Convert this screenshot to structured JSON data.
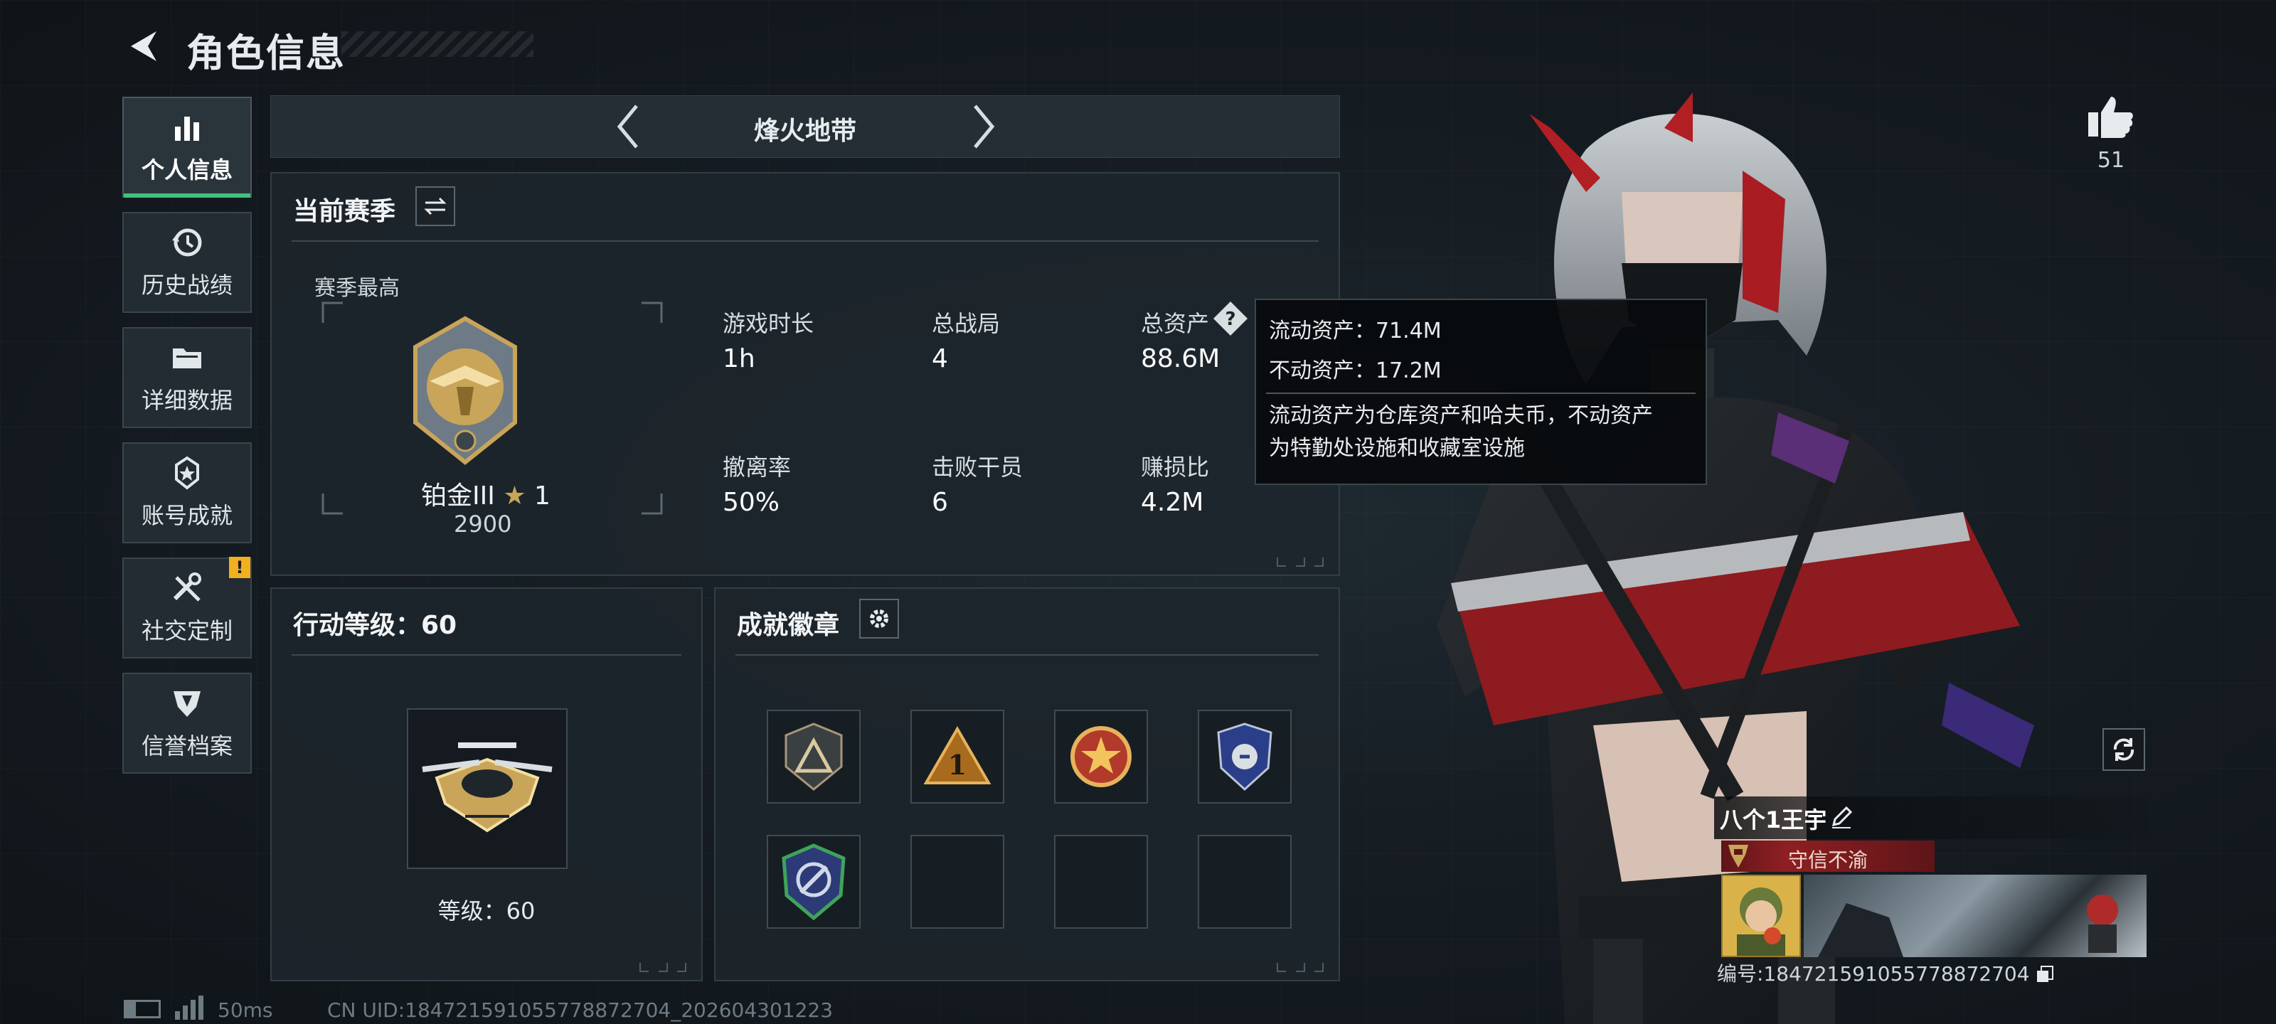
{
  "header": {
    "title": "角色信息"
  },
  "sidebar": {
    "items": [
      {
        "label": "个人信息",
        "icon": "bar-chart-icon"
      },
      {
        "label": "历史战绩",
        "icon": "history-clock-icon"
      },
      {
        "label": "详细数据",
        "icon": "folder-icon"
      },
      {
        "label": "账号成就",
        "icon": "achievement-star-icon"
      },
      {
        "label": "社交定制",
        "icon": "tools-icon"
      },
      {
        "label": "信誉档案",
        "icon": "shield-emblem-icon"
      }
    ],
    "warning_badge": "!"
  },
  "mode_bar": {
    "name": "烽火地带"
  },
  "season_panel": {
    "title": "当前赛季",
    "best_label": "赛季最高",
    "rank_name": "铂金III",
    "rank_stars": "1",
    "rank_points": "2900",
    "stats": [
      {
        "label": "游戏时长",
        "value": "1h"
      },
      {
        "label": "总战局",
        "value": "4"
      },
      {
        "label": "总资产",
        "value": "88.6M"
      },
      {
        "label": "撤离率",
        "value": "50%"
      },
      {
        "label": "击败干员",
        "value": "6"
      },
      {
        "label": "赚损比",
        "value": "4.2M"
      }
    ]
  },
  "tooltip": {
    "liquid": "流动资产：71.4M",
    "fixed": "不动资产：17.2M",
    "desc_line1": "流动资产为仓库资产和哈夫币，不动资产",
    "desc_line2": "为特勤处设施和收藏室设施"
  },
  "level_panel": {
    "title": "行动等级：60",
    "level_label": "等级：60"
  },
  "achievements_panel": {
    "title": "成就徽章",
    "badges": [
      "triangle-badge",
      "number-one-badge",
      "star-medal-badge",
      "wing-shield-badge",
      "satellite-badge",
      "",
      "",
      ""
    ]
  },
  "profile": {
    "likes": "51",
    "player_name": "八个1王宇",
    "tag": "守信不渝",
    "id_text": "编号:184721591055778872704"
  },
  "status": {
    "ping": "50ms",
    "uid": "CN UID:184721591055778872704_202604301223"
  },
  "colors": {
    "accent_green": "#3ec47b",
    "warning": "#f2b01e",
    "rank_gold": "#c9a55a",
    "tag_red": "#8e1f22"
  }
}
